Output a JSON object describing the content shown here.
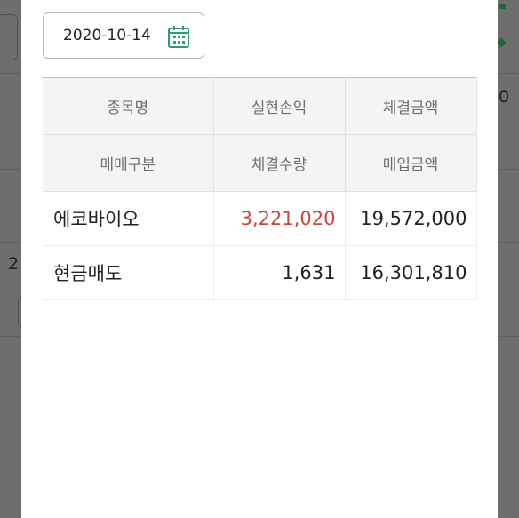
{
  "background": {
    "left_digit": "2",
    "right_digit": "0"
  },
  "date_picker": {
    "value": "2020-10-14",
    "icon": "calendar-icon"
  },
  "table": {
    "header_row1": [
      "종목명",
      "실현손익",
      "체결금액"
    ],
    "header_row2": [
      "매매구분",
      "체결수량",
      "매입금액"
    ],
    "rows": [
      [
        "에코바이오",
        "3,221,020",
        "19,572,000"
      ],
      [
        "현금매도",
        "1,631",
        "16,301,810"
      ]
    ]
  },
  "colors": {
    "profit": "#c9453f",
    "accent_green": "#1f6a3b"
  }
}
